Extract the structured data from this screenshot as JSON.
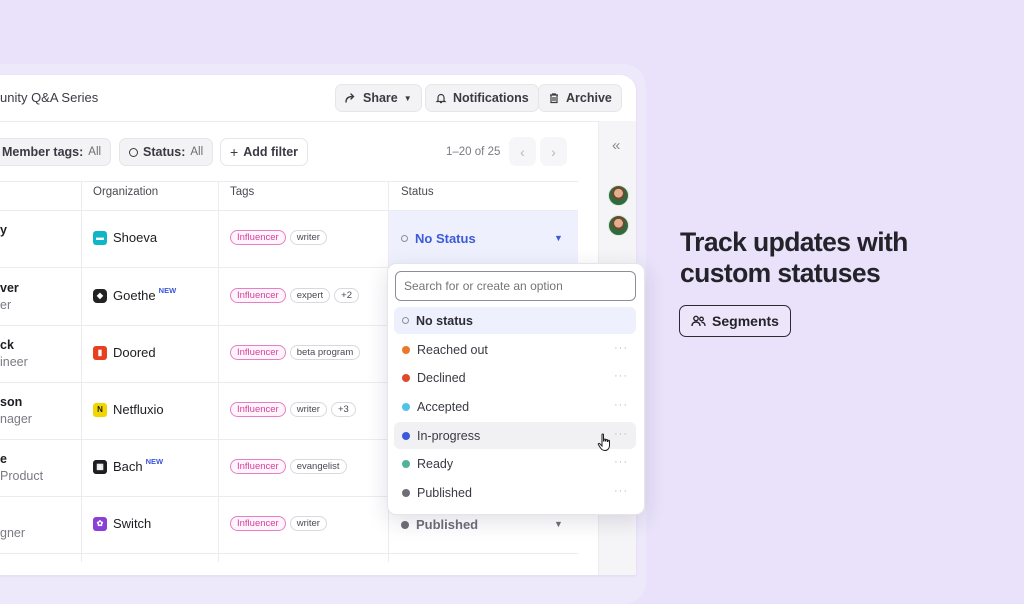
{
  "header": {
    "title": "unity Q&A Series",
    "share_label": "Share",
    "notifications_label": "Notifications",
    "archive_label": "Archive"
  },
  "filters": {
    "member_tags_label": "Member tags:",
    "member_tags_value": "All",
    "status_label": "Status:",
    "status_value": "All",
    "add_filter_label": "Add filter"
  },
  "pagination": {
    "range": "1–20 of 25",
    "prev": "‹",
    "next": "›"
  },
  "columns": [
    "Organization",
    "Tags",
    "Status"
  ],
  "rows": [
    {
      "name_a": "y",
      "name_b": "",
      "org": "Shoeva",
      "org_new": "",
      "org_color": "#10b5c9",
      "org_glyph": "",
      "tags": [
        "Influencer",
        "writer"
      ],
      "status": "No Status",
      "status_color": ""
    },
    {
      "name_a": "ver",
      "name_b": "er",
      "org": "Goethe",
      "org_new": "NEW",
      "org_color": "#222222",
      "org_glyph": "",
      "tags": [
        "Influencer",
        "expert",
        "+2"
      ],
      "status": "",
      "status_color": ""
    },
    {
      "name_a": "ck",
      "name_b": "ineer",
      "org": "Doored",
      "org_new": "",
      "org_color": "#e8401f",
      "org_glyph": "",
      "tags": [
        "Influencer",
        "beta program"
      ],
      "status": "",
      "status_color": ""
    },
    {
      "name_a": "son",
      "name_b": "nager",
      "org": "Netfluxio",
      "org_new": "",
      "org_color": "#f2d600",
      "org_glyph": "N",
      "tags": [
        "Influencer",
        "writer",
        "+3"
      ],
      "status": "",
      "status_color": ""
    },
    {
      "name_a": "e",
      "name_b": "Product",
      "org": "Bach",
      "org_new": "NEW",
      "org_color": "#1d1d22",
      "org_glyph": "",
      "tags": [
        "Influencer",
        "evangelist"
      ],
      "status": "",
      "status_color": ""
    },
    {
      "name_a": "",
      "name_b": "gner",
      "org": "Switch",
      "org_new": "",
      "org_color": "#8b3fd9",
      "org_glyph": "",
      "tags": [
        "Influencer",
        "writer"
      ],
      "status": "Published",
      "status_color": "#6e6e76"
    }
  ],
  "dropdown": {
    "placeholder": "Search for or create an option",
    "options": [
      {
        "label": "No status",
        "color": "",
        "more": ""
      },
      {
        "label": "Reached out",
        "color": "#e8782a",
        "more": "···"
      },
      {
        "label": "Declined",
        "color": "#e04a2a",
        "more": "···"
      },
      {
        "label": "Accepted",
        "color": "#4fc3e8",
        "more": "···"
      },
      {
        "label": "In-progress",
        "color": "#3d5ad8",
        "more": "···"
      },
      {
        "label": "Ready",
        "color": "#4db39a",
        "more": "···"
      },
      {
        "label": "Published",
        "color": "#6e6e76",
        "more": "···"
      }
    ]
  },
  "promo": {
    "headline": "Track updates with custom statuses",
    "segments_label": "Segments"
  },
  "icons": {
    "share": "share-icon",
    "bell": "bell-icon",
    "archive": "archive-icon",
    "collapse": "double-chevron-left-icon",
    "segments": "users-icon",
    "cursor": "pointer-hand-icon"
  },
  "colors": {
    "background": "#e9e2fa",
    "accent": "#3d5ad8",
    "pink_tag": "#d6409f"
  }
}
